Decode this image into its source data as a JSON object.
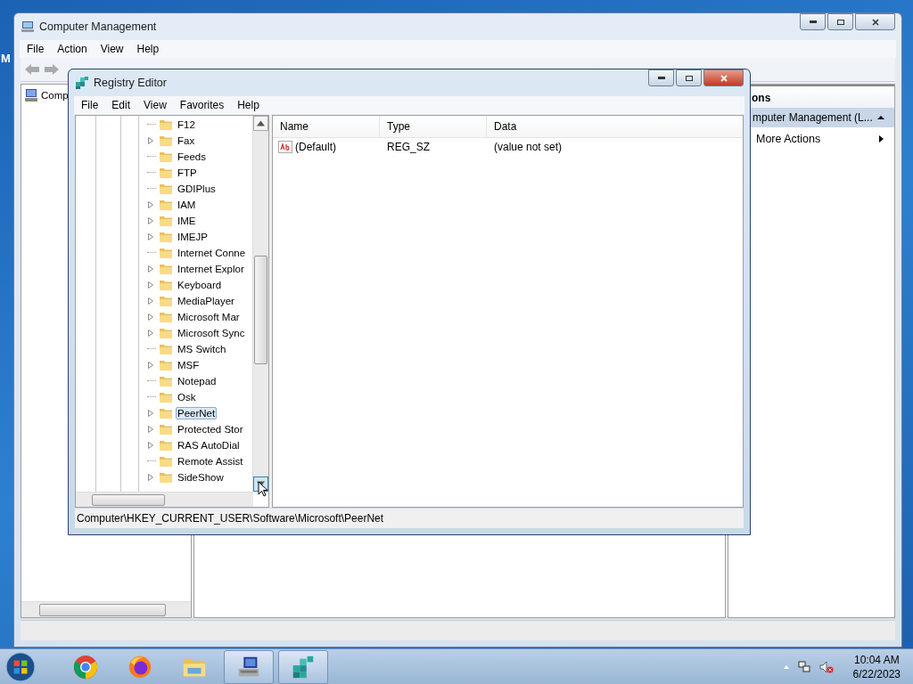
{
  "desktop": {
    "icon_label": "M"
  },
  "computer_management": {
    "title": "Computer Management",
    "menu": [
      "File",
      "Action",
      "View",
      "Help"
    ],
    "tree_item": "Comp",
    "actions": {
      "header": "ons",
      "group": "mputer Management (L...",
      "items": [
        "More Actions"
      ]
    }
  },
  "registry_editor": {
    "title": "Registry Editor",
    "menu": [
      "File",
      "Edit",
      "View",
      "Favorites",
      "Help"
    ],
    "tree_items": [
      {
        "label": "F12",
        "expandable": false,
        "selected": false
      },
      {
        "label": "Fax",
        "expandable": true,
        "selected": false
      },
      {
        "label": "Feeds",
        "expandable": false,
        "selected": false
      },
      {
        "label": "FTP",
        "expandable": false,
        "selected": false
      },
      {
        "label": "GDIPlus",
        "expandable": false,
        "selected": false
      },
      {
        "label": "IAM",
        "expandable": true,
        "selected": false
      },
      {
        "label": "IME",
        "expandable": true,
        "selected": false
      },
      {
        "label": "IMEJP",
        "expandable": true,
        "selected": false
      },
      {
        "label": "Internet Conne",
        "expandable": false,
        "selected": false
      },
      {
        "label": "Internet Explor",
        "expandable": true,
        "selected": false
      },
      {
        "label": "Keyboard",
        "expandable": true,
        "selected": false
      },
      {
        "label": "MediaPlayer",
        "expandable": true,
        "selected": false
      },
      {
        "label": "Microsoft Mar",
        "expandable": true,
        "selected": false
      },
      {
        "label": "Microsoft Sync",
        "expandable": true,
        "selected": false
      },
      {
        "label": "MS Switch",
        "expandable": false,
        "selected": false
      },
      {
        "label": "MSF",
        "expandable": true,
        "selected": false
      },
      {
        "label": "Notepad",
        "expandable": false,
        "selected": false
      },
      {
        "label": "Osk",
        "expandable": false,
        "selected": false
      },
      {
        "label": "PeerNet",
        "expandable": true,
        "selected": true
      },
      {
        "label": "Protected Stor",
        "expandable": true,
        "selected": false
      },
      {
        "label": "RAS AutoDial",
        "expandable": true,
        "selected": false
      },
      {
        "label": "Remote Assist",
        "expandable": false,
        "selected": false
      },
      {
        "label": "SideShow",
        "expandable": true,
        "selected": false
      }
    ],
    "columns": [
      "Name",
      "Type",
      "Data"
    ],
    "rows": [
      {
        "name": "(Default)",
        "type": "REG_SZ",
        "data": "(value not set)"
      }
    ],
    "status_bar": "Computer\\HKEY_CURRENT_USER\\Software\\Microsoft\\PeerNet"
  },
  "taskbar": {
    "apps": [
      {
        "kind": "chrome",
        "active": false
      },
      {
        "kind": "firefox",
        "active": false
      },
      {
        "kind": "explorer",
        "active": false
      },
      {
        "kind": "compmgmt",
        "active": true
      },
      {
        "kind": "regedit",
        "active": true
      }
    ],
    "time": "10:04 AM",
    "date": "6/22/2023"
  }
}
